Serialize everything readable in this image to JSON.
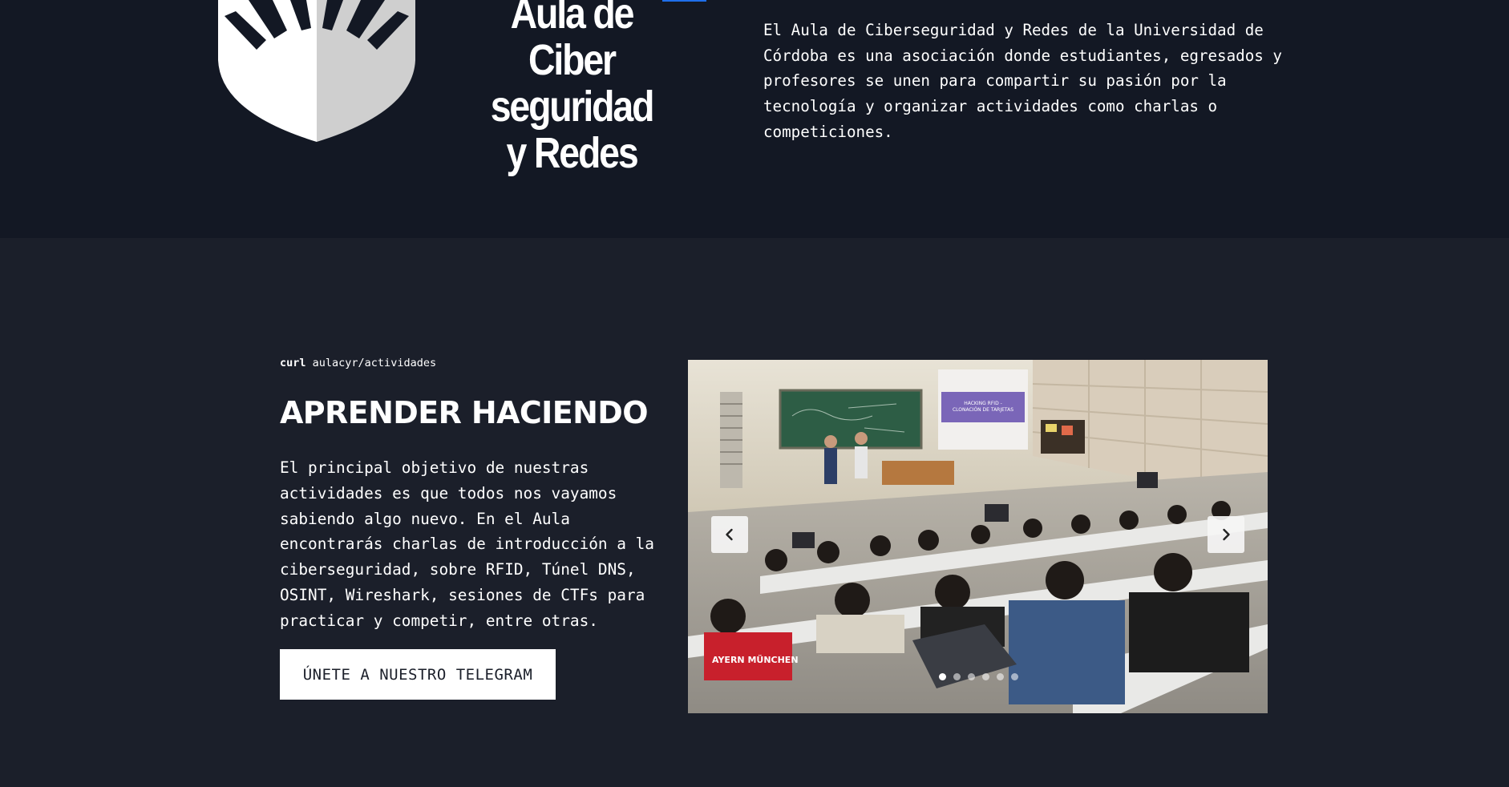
{
  "logo": {
    "line1": "Aula de",
    "line2": "Ciber seguridad",
    "line3": "y Redes"
  },
  "hero": {
    "description": "El Aula de Ciberseguridad y Redes de la Universidad de\nCórdoba es una asociación donde estudiantes, egresados y\nprofesores se unen para compartir su pasión por la\ntecnología y organizar actividades como charlas o\ncompeticiones."
  },
  "activities": {
    "cmd_keyword": "curl",
    "cmd_arg": "aulacyr/actividades",
    "title": "APRENDER HACIENDO",
    "body": "El principal objetivo de nuestras actividades es que todos nos vayamos sabiendo algo nuevo. En el Aula encontrarás charlas de introducción a la ciberseguridad, sobre RFID, Túnel DNS, OSINT, Wireshark, sesiones de CTFs para practicar y competir, entre otras.",
    "cta_label": "ÚNETE A NUESTRO TELEGRAM"
  },
  "carousel": {
    "slide_count": 6,
    "active_index": 0,
    "prev_icon": "chevron-left-icon",
    "next_icon": "chevron-right-icon",
    "photo_text": {
      "banner": "HACKING RFID - CLONACIÓN DE TARJETAS",
      "shirt": "AYERN MÜNCHEN"
    }
  },
  "colors": {
    "hero_bg": "#131824",
    "section_bg": "#1b1f2a",
    "accent": "#1f6feb",
    "text": "#ffffff"
  }
}
